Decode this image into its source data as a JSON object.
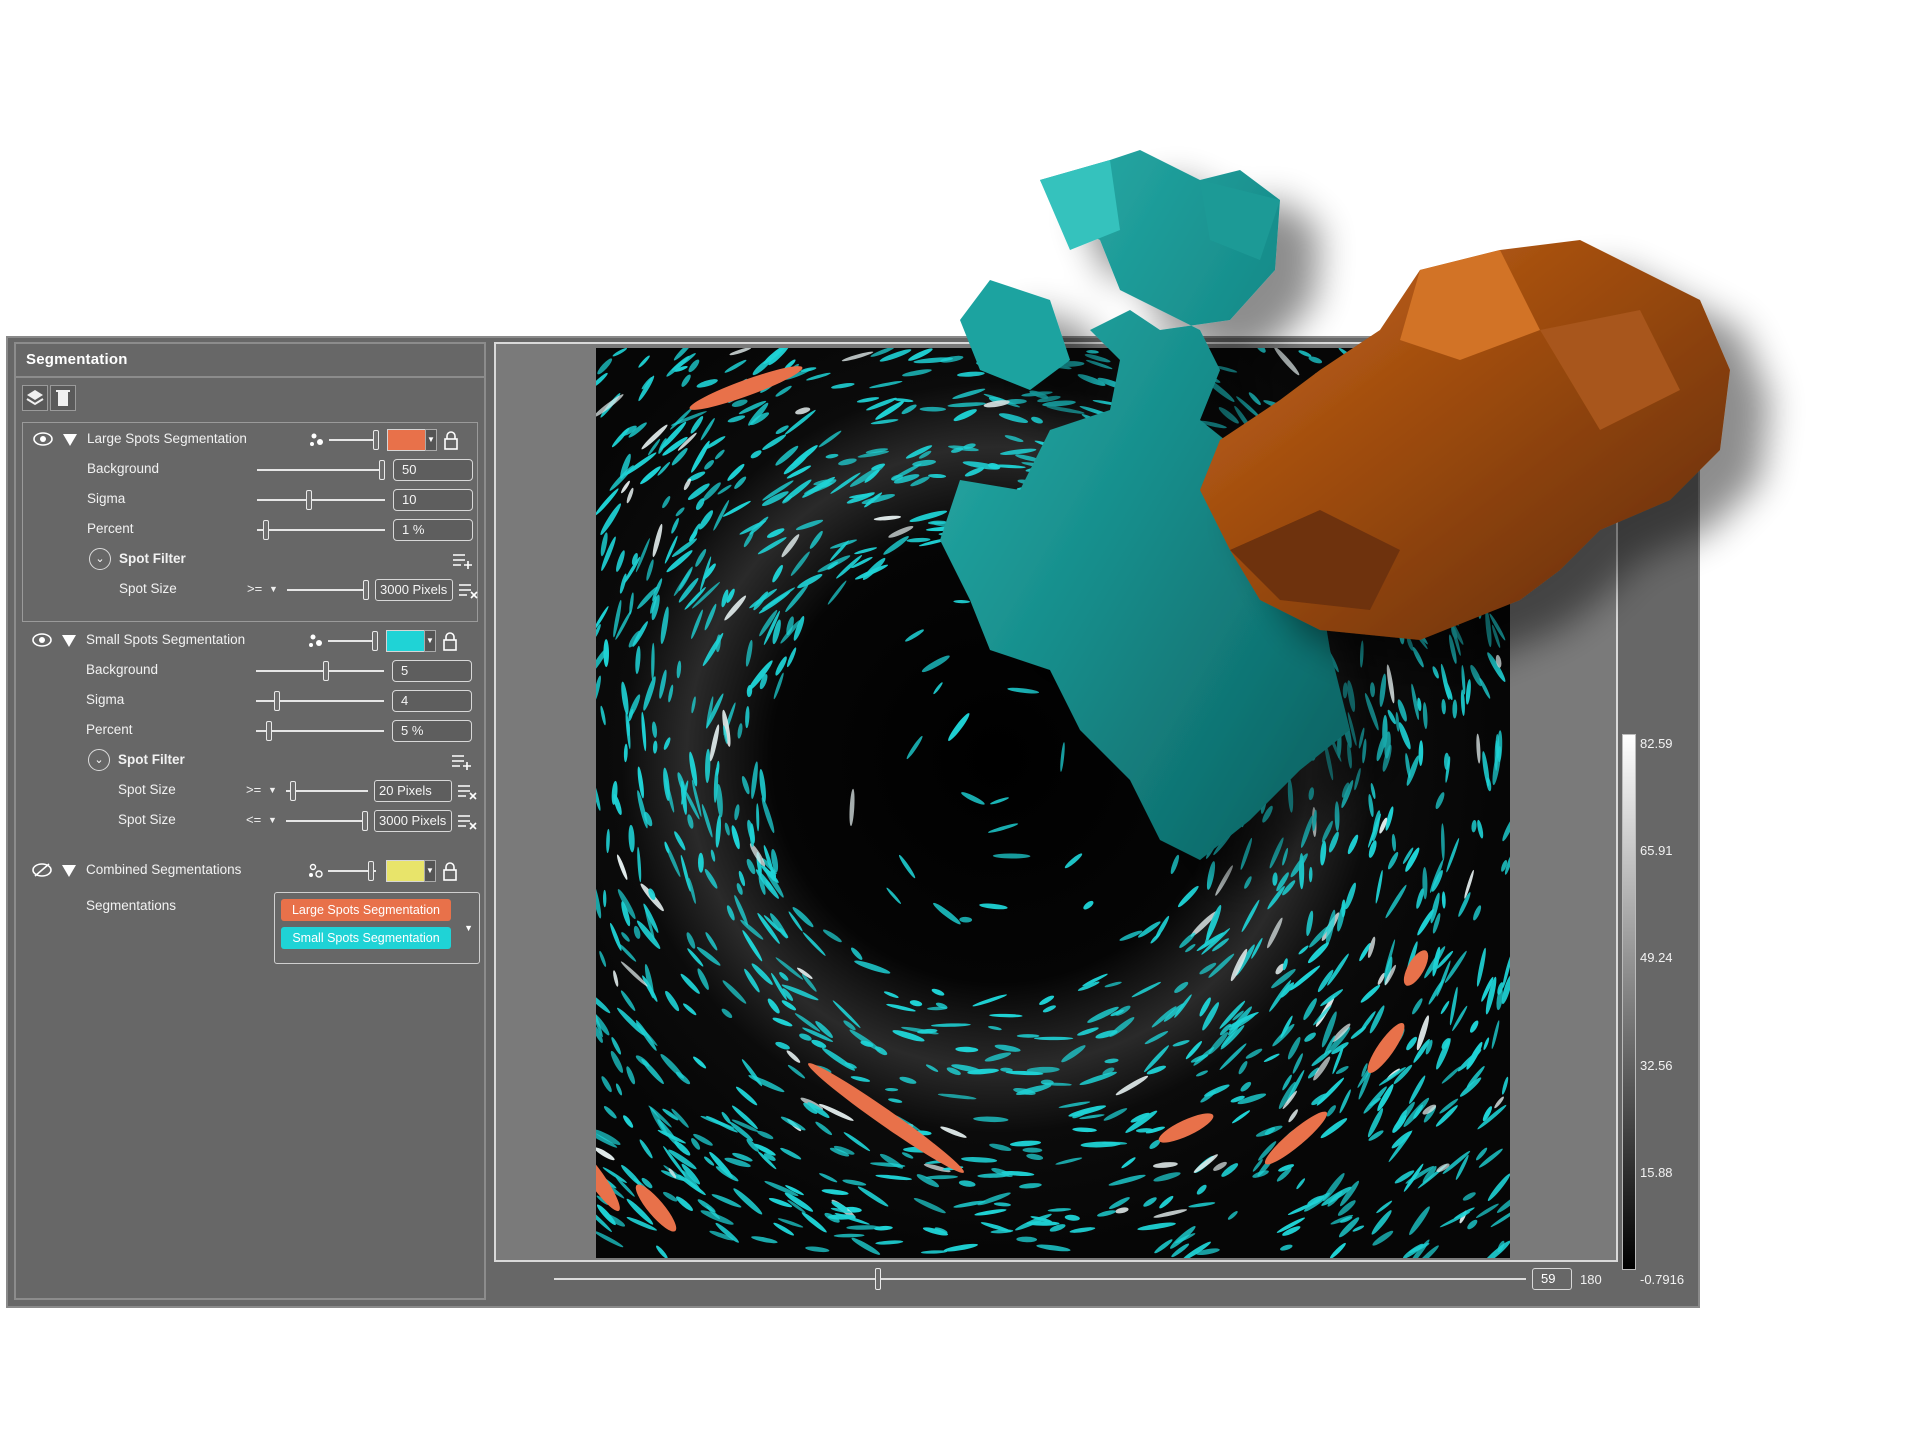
{
  "panel": {
    "title": "Segmentation",
    "toolbar": {
      "icons": [
        "layers-icon",
        "trash-icon"
      ]
    }
  },
  "large_spots": {
    "title": "Large Spots Segmentation",
    "color": "#e8714a",
    "background": {
      "label": "Background",
      "value": "50",
      "level": 1.0
    },
    "sigma": {
      "label": "Sigma",
      "value": "10",
      "level": 0.4
    },
    "percent": {
      "label": "Percent",
      "value": "1 %",
      "level": 0.05
    },
    "spot_filter": {
      "label": "Spot Filter"
    },
    "spot_size": {
      "label": "Spot Size",
      "operator": ">=",
      "value": "3000 Pixels",
      "level": 1.0
    }
  },
  "small_spots": {
    "title": "Small Spots Segmentation",
    "color": "#1fd3d6",
    "background": {
      "label": "Background",
      "value": "5",
      "level": 0.55
    },
    "sigma": {
      "label": "Sigma",
      "value": "4",
      "level": 0.15
    },
    "percent": {
      "label": "Percent",
      "value": "5 %",
      "level": 0.08
    },
    "spot_filter": {
      "label": "Spot Filter"
    },
    "spot_size_min": {
      "label": "Spot Size",
      "operator": ">=",
      "value": "20 Pixels",
      "level": 0.05
    },
    "spot_size_max": {
      "label": "Spot Size",
      "operator": "<=",
      "value": "3000 Pixels",
      "level": 1.0
    }
  },
  "combined": {
    "title": "Combined Segmentations",
    "color": "#e8e46a",
    "segmentations_label": "Segmentations",
    "items": [
      {
        "label": "Large Spots Segmentation",
        "color": "#e8714a"
      },
      {
        "label": "Small Spots Segmentation",
        "color": "#1fd3d6"
      }
    ]
  },
  "viewer": {
    "scale_labels": [
      "82.59",
      "65.91",
      "49.24",
      "32.56",
      "15.88",
      "-0.7916"
    ],
    "slice_value": "59",
    "slice_max": "180",
    "slice_level": 0.33
  }
}
